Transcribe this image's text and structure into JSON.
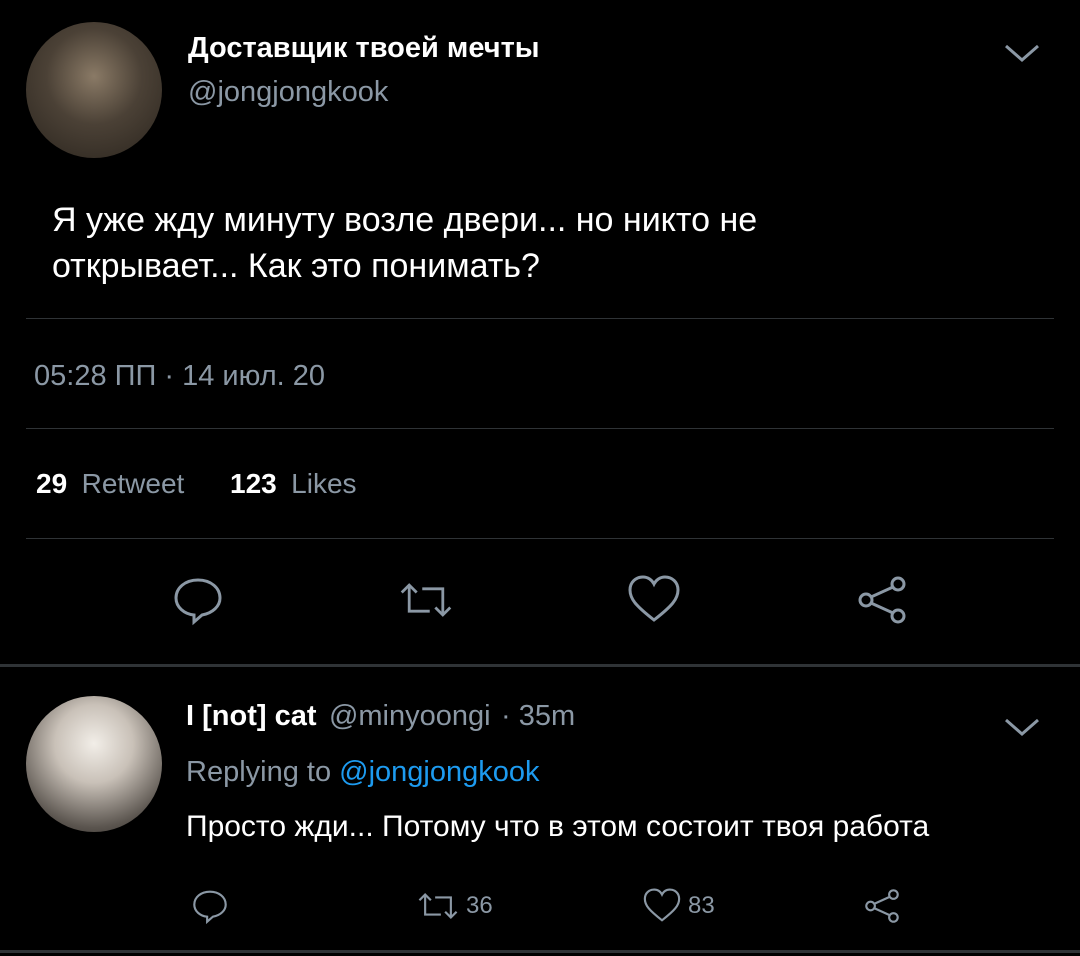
{
  "main_tweet": {
    "display_name": "Доставщик твоей мечты",
    "handle": "@jongjongkook",
    "text_line1": "Я уже жду минуту возле двери... но никто не",
    "text_line2": "открывает... Как это понимать?",
    "timestamp": "05:28 ПП · 14 июл. 20",
    "retweet_count": "29",
    "retweet_label": "Retweet",
    "like_count": "123",
    "like_label": "Likes",
    "actions": [
      "reply-icon",
      "retweet-icon",
      "like-icon",
      "share-icon"
    ]
  },
  "reply": {
    "display_name": "I [not] cat",
    "handle": "@minyoongi",
    "time": "· 35m",
    "replying_prefix": "Replying to",
    "replying_to": "@jongjongkook",
    "text": "Просто жди... Потому что в этом состоит твоя работа",
    "retweets": "36",
    "likes": "83"
  },
  "colors": {
    "background": "#000000",
    "text": "#ffffff",
    "muted": "#8b98a5",
    "link": "#1d9bf0",
    "divider": "#2f3336"
  }
}
